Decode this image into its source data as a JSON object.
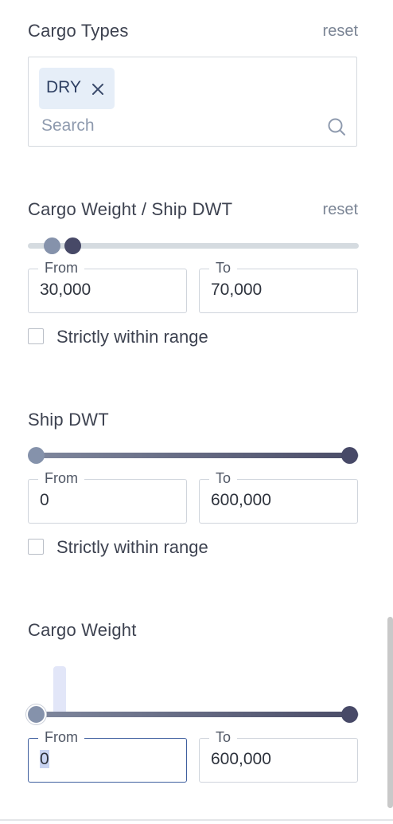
{
  "cargo_types": {
    "title": "Cargo Types",
    "reset_label": "reset",
    "chips": [
      {
        "label": "DRY",
        "remove_icon": "close-icon"
      }
    ],
    "search_placeholder": "Search",
    "search_icon": "search-icon"
  },
  "cargo_weight_ship_dwt": {
    "title": "Cargo Weight / Ship DWT",
    "reset_label": "reset",
    "slider_from_fraction": 0.072,
    "slider_to_fraction": 0.135,
    "from_label": "From",
    "from_value": "30,000",
    "to_label": "To",
    "to_value": "70,000",
    "strict_label": "Strictly within range",
    "strict_checked": false
  },
  "ship_dwt": {
    "title": "Ship DWT",
    "slider_from_fraction": 0.0,
    "slider_to_fraction": 1.0,
    "from_label": "From",
    "from_value": "0",
    "to_label": "To",
    "to_value": "600,000",
    "strict_label": "Strictly within range",
    "strict_checked": false
  },
  "cargo_weight": {
    "title": "Cargo Weight",
    "slider_from_fraction": 0.0,
    "slider_to_fraction": 1.0,
    "from_label": "From",
    "from_value": "0",
    "to_label": "To",
    "to_value": "600,000"
  },
  "colors": {
    "track": "#d5dbe0",
    "handle_light": "#8592ab",
    "handle_dark": "#474967",
    "chip_bg": "#e6eef8",
    "focus_border": "#3f5f9f"
  }
}
